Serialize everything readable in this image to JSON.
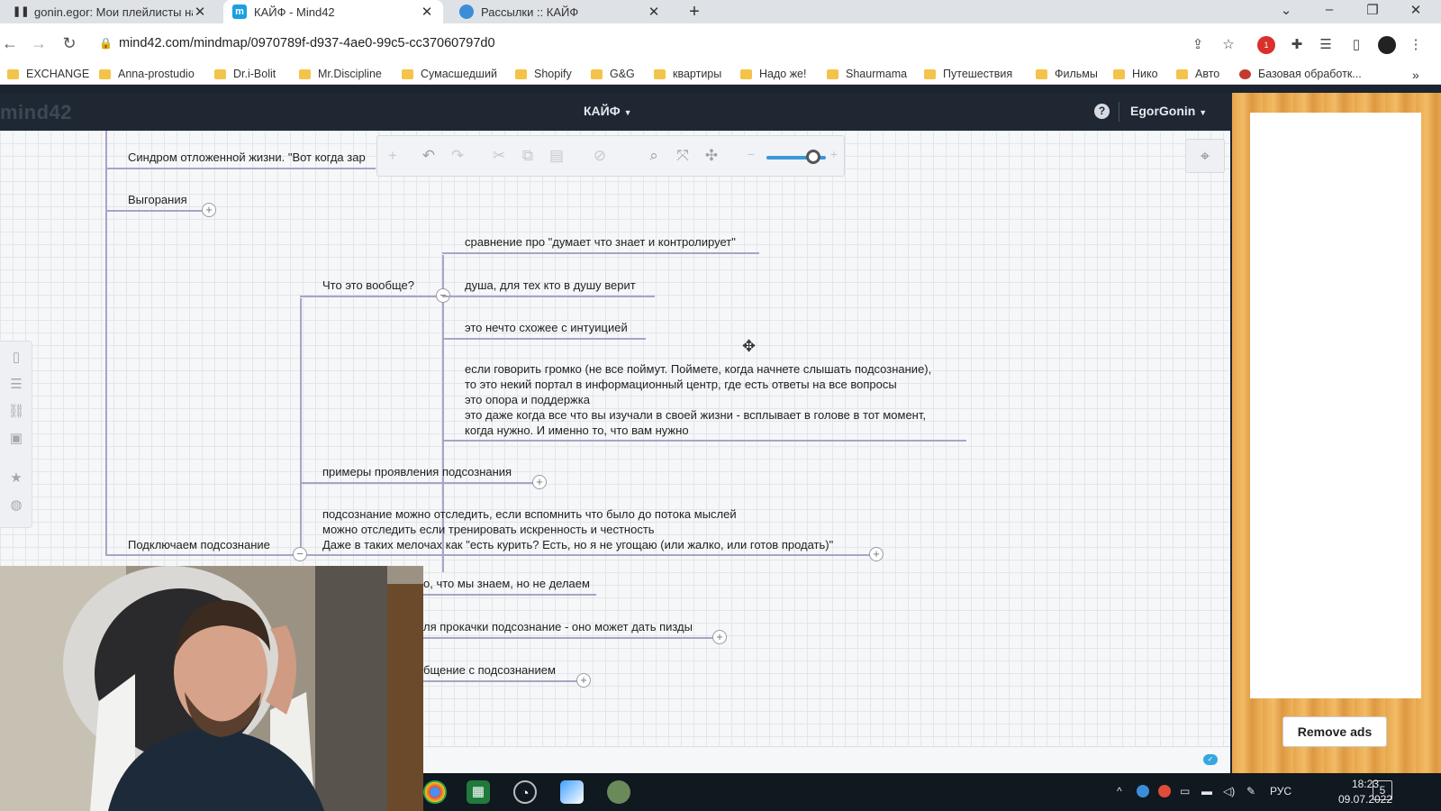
{
  "browser": {
    "tabs": [
      {
        "title": "gonin.egor: Мои плейлисты на",
        "favicon": "pause-icon",
        "active": false
      },
      {
        "title": "КАЙФ - Mind42",
        "favicon": "mind42-icon",
        "active": true
      },
      {
        "title": "Рассылки :: КАЙФ",
        "favicon": "globe-icon",
        "active": false
      }
    ],
    "url": "mind42.com/mindmap/0970789f-d937-4ae0-99c5-cc37060797d0",
    "bookmarks": [
      "EXCHANGE",
      "Anna-prostudio",
      "Dr.i-Bolit",
      "Mr.Discipline",
      "Сумасшедший",
      "Shopify",
      "G&G",
      "квартиры",
      "Надо же!",
      "Shaurmama",
      "Путешествия",
      "Фильмы",
      "Нико",
      "Авто",
      "Базовая обработк..."
    ],
    "extension_badge": "1"
  },
  "app": {
    "logo": "mind42",
    "map_title": "КАЙФ",
    "user": "EgorGonin",
    "remove_ads": "Remove ads"
  },
  "mindmap": {
    "nodes": {
      "syndrome": "Синдром отложенной жизни. \"Вот когда зар",
      "burnout": "Выгорания",
      "what_is": "Что это вообще?",
      "compare": "сравнение про \"думает что знает и контролирует\"",
      "soul": "душа, для тех кто в душу верит",
      "intuition": "это нечто схожее с интуицией",
      "loud": [
        "если говорить громко (не все поймут. Поймете, когда начнете слышать подсознание),",
        "то это некий портал в информационный центр, где есть ответы на все вопросы",
        "это опора и поддержка",
        "это даже когда все что вы изучали в своей жизни - всплывает в голове в тот момент,",
        "когда нужно. И именно то, что вам нужно"
      ],
      "examples": "примеры проявления подсознания",
      "track": [
        "подсознание можно отследить, если вспомнить что было до потока мыслей",
        "можно отследить если тренировать искренность и честность",
        "Даже в таких мелочах как \"есть курить? Есть, но я не угощаю (или жалко, или готов продать)\""
      ],
      "connect": "Подключаем подсознание",
      "know_not_do": "о, что мы знаем, но не делаем",
      "pumping": "ля прокачки подсознание - оно может дать пизды",
      "communication": "бщение с подсознанием"
    }
  },
  "taskbar": {
    "language": "РУС",
    "time": "18:23",
    "date": "09.07.2022",
    "notifications": "5"
  }
}
